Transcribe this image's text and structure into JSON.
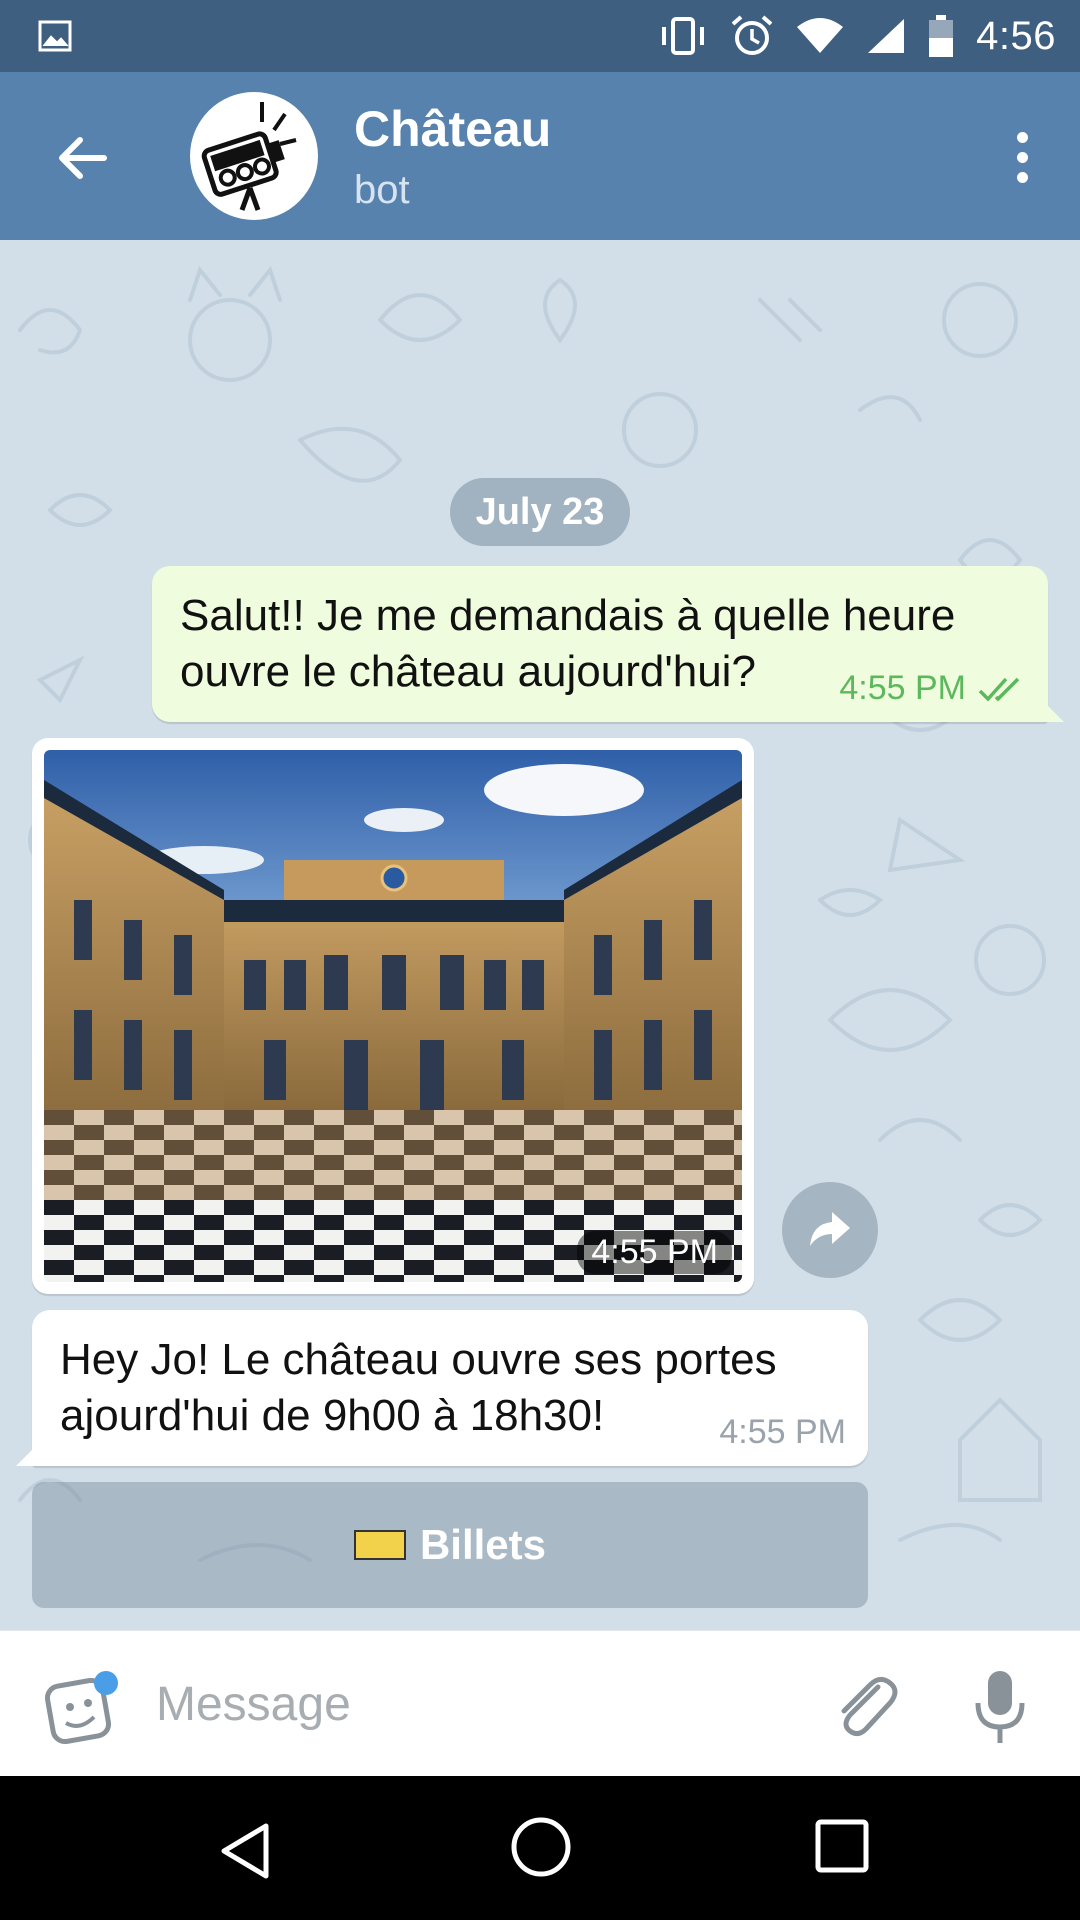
{
  "status_bar": {
    "time": "4:56",
    "icons": [
      "image-icon",
      "vibrate-icon",
      "alarm-icon",
      "wifi-icon",
      "signal-icon",
      "battery-icon"
    ]
  },
  "header": {
    "title": "Château",
    "subtitle": "bot",
    "icons": [
      "back-arrow-icon",
      "bot-avatar",
      "more-vert-icon"
    ]
  },
  "chat": {
    "date_chip": "July 23",
    "messages": [
      {
        "direction": "outgoing",
        "text": "Salut!! Je me demandais à quelle heure ouvre le château aujourd'hui?",
        "time": "4:55 PM",
        "status": "read"
      },
      {
        "direction": "incoming",
        "type": "photo",
        "time": "4:55 PM"
      },
      {
        "direction": "incoming",
        "text": "Hey Jo! Le château ouvre ses portes ajourd'hui de 9h00 à 18h30!",
        "time": "4:55 PM"
      }
    ],
    "inline_button": {
      "label": "Billets",
      "icon": "ticket-icon"
    }
  },
  "input_bar": {
    "placeholder": "Message",
    "icons": [
      "sticker-icon",
      "attach-icon",
      "mic-icon"
    ]
  },
  "nav_bar": {
    "icons": [
      "nav-back-icon",
      "nav-home-icon",
      "nav-recents-icon"
    ]
  },
  "colors": {
    "status_bar": "#3f5f80",
    "app_bar": "#5682ad",
    "chat_bg": "#d2dfe8",
    "outgoing_bubble": "#effdde",
    "outgoing_meta": "#5db85d",
    "incoming_meta": "#9aa3ab"
  }
}
